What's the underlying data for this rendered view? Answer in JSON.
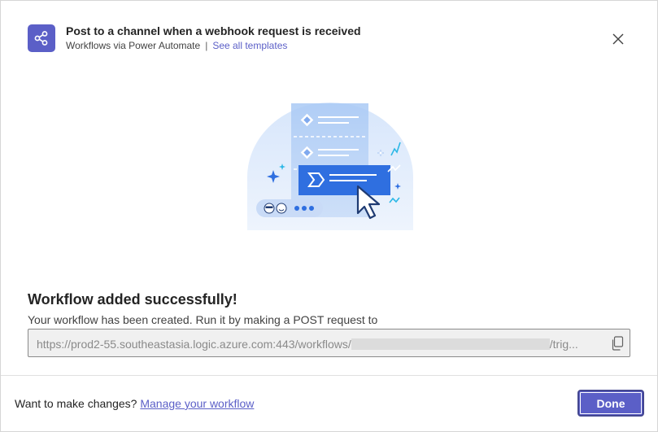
{
  "header": {
    "title": "Post to a channel when a webhook request is received",
    "subtitle": "Workflows via Power Automate",
    "separator": "|",
    "templates_link": "See all templates",
    "icon": "share-nodes-icon",
    "close_icon": "close-icon"
  },
  "main": {
    "success_title": "Workflow added successfully!",
    "success_desc": "Your workflow has been created. Run it by making a POST request to",
    "url_prefix": "https://prod2-55.southeastasia.logic.azure.com:443/workflows/",
    "url_suffix": "/trig...",
    "copy_icon": "copy-icon",
    "illustration": "workflow-illustration"
  },
  "footer": {
    "prompt": "Want to make changes?",
    "manage_link": "Manage your workflow",
    "done_label": "Done"
  },
  "colors": {
    "accent": "#5b5fc7",
    "accent_dark": "#444791",
    "text": "#242424",
    "field_bg": "#f0f0f0"
  }
}
